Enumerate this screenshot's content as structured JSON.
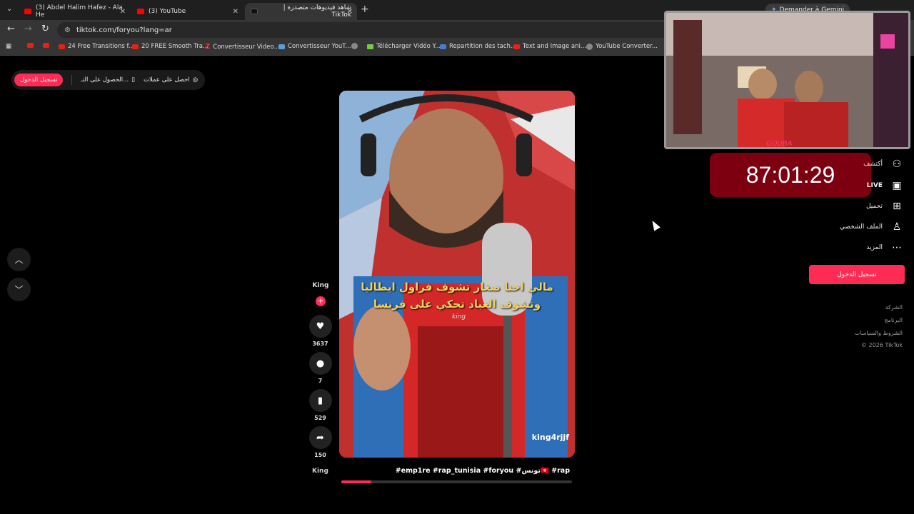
{
  "browser": {
    "tabs": [
      {
        "label": "(3) Abdel Halim Hafez - Ala He"
      },
      {
        "label": "(3) YouTube"
      },
      {
        "label": "شاهد فيديوهات متصدرة | TikTok"
      }
    ],
    "gemini_label": "Demander à Gemini",
    "url": "tiktok.com/foryou?lang=ar",
    "bookmarks": [
      {
        "label": "24 Free Transitions f..."
      },
      {
        "label": "20 FREE Smooth Tra..."
      },
      {
        "label": "Convertisseur Video..."
      },
      {
        "label": "Convertisseur YouT..."
      },
      {
        "label": "Télécharger Vidéo Y..."
      },
      {
        "label": "Repartition des tach..."
      },
      {
        "label": "Text and Image ani..."
      },
      {
        "label": "YouTube Converter..."
      }
    ]
  },
  "top_bar": {
    "login_label": "تسجيل الدخول",
    "get_app_label": "الحصول على التـ...",
    "coins_label": "احصل على عملات"
  },
  "video": {
    "caption_line1": "مالي احنا صغار تشوف فراول ايطاليا",
    "caption_line2": "وتشوف العباد تحكي على فرنسا",
    "watermark": "king",
    "username": "king4rjjf",
    "hashtags": "#emp1re #rap_tunisia #foryou #تونس🇹🇳 #rap",
    "progress": 0.13
  },
  "actions": {
    "avatar_label": "King",
    "likes": "3637",
    "comments": "7",
    "saves": "529",
    "shares": "150",
    "bottom_avatar_label": "King"
  },
  "overlay": {
    "webcam_tag": "GOUBA",
    "timer": "87:01:29"
  },
  "sidebar": {
    "items": [
      {
        "label": "أكتشف",
        "icon": "user-plus-icon"
      },
      {
        "label": "LIVE",
        "icon": "live-icon"
      },
      {
        "label": "تحميل",
        "icon": "upload-icon"
      },
      {
        "label": "الملف الشخصي",
        "icon": "profile-icon"
      },
      {
        "label": "المزيد",
        "icon": "more-icon"
      }
    ],
    "login_label": "تسجيل الدخول",
    "footer": [
      "الشركة",
      "البرنامج",
      "الشروط والسياسات",
      "© 2026 TikTok"
    ]
  },
  "colors": {
    "accent": "#fe2c55",
    "timer_bg": "#7d0010"
  }
}
